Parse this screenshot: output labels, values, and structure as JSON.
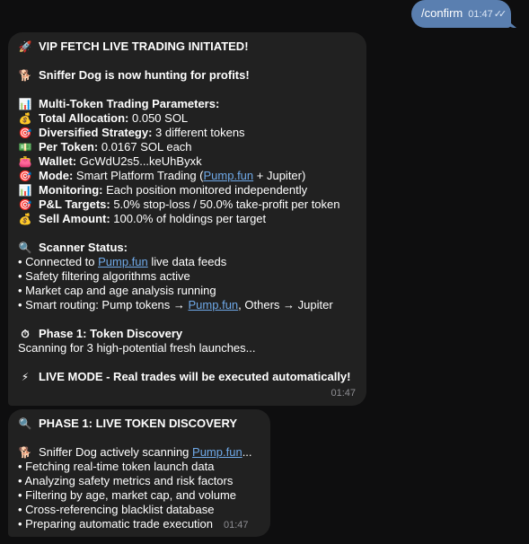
{
  "outgoing": {
    "text": "/confirm",
    "time": "01:47",
    "ticks": "✓✓"
  },
  "msg1": {
    "title": {
      "emoji": "🚀",
      "text": "VIP FETCH LIVE TRADING INITIATED!"
    },
    "hunting": {
      "emoji": "🐕",
      "text": "Sniffer Dog is now hunting for profits!"
    },
    "params_header": {
      "emoji": "📊",
      "text": "Multi-Token Trading Parameters:"
    },
    "allocation": {
      "emoji": "💰",
      "label": "Total Allocation:",
      "value": " 0.050 SOL"
    },
    "strategy": {
      "emoji": "🎯",
      "label": "Diversified Strategy:",
      "value": " 3 different tokens"
    },
    "per_token": {
      "emoji": "💵",
      "label": "Per Token:",
      "value": " 0.0167 SOL each"
    },
    "wallet": {
      "emoji": "👛",
      "label": "Wallet:",
      "value": " GcWdU2s5...keUhByxk"
    },
    "mode": {
      "emoji": "🎯",
      "label": "Mode:",
      "pre": " Smart Platform Trading (",
      "link": "Pump.fun",
      "post": " + Jupiter)"
    },
    "monitoring": {
      "emoji": "📊",
      "label": "Monitoring:",
      "value": " Each position monitored independently"
    },
    "pl": {
      "emoji": "🎯",
      "label": "P&L Targets:",
      "value": " 5.0% stop-loss / 50.0% take-profit per token"
    },
    "sell": {
      "emoji": "💰",
      "label": "Sell Amount:",
      "value": " 100.0% of holdings per target"
    },
    "scanner_header": {
      "emoji": "🔍",
      "text": "Scanner Status:"
    },
    "scan1": {
      "pre": "• Connected to ",
      "link": "Pump.fun",
      "post": " live data feeds"
    },
    "scan2": "• Safety filtering algorithms active",
    "scan3": "• Market cap and age analysis running",
    "scan4": {
      "pre": "• Smart routing: Pump tokens → ",
      "link": "Pump.fun",
      "post": ", Others → Jupiter"
    },
    "phase": {
      "emoji": "⏱",
      "text": "Phase 1: Token Discovery"
    },
    "phase_desc": "Scanning for 3 high-potential fresh launches...",
    "live": {
      "emoji": "⚡",
      "text": "LIVE MODE - Real trades will be executed automatically!"
    },
    "time": "01:47"
  },
  "msg2": {
    "title": {
      "emoji": "🔍",
      "text": "PHASE 1: LIVE TOKEN DISCOVERY"
    },
    "scanning": {
      "emoji": "🐕",
      "pre": "Sniffer Dog actively scanning ",
      "link": "Pump.fun",
      "post": "..."
    },
    "items": [
      "• Fetching real-time token launch data",
      "• Analyzing safety metrics and risk factors",
      "• Filtering by age, market cap, and volume",
      "• Cross-referencing blacklist database",
      "• Preparing automatic trade execution"
    ],
    "time": "01:47"
  }
}
